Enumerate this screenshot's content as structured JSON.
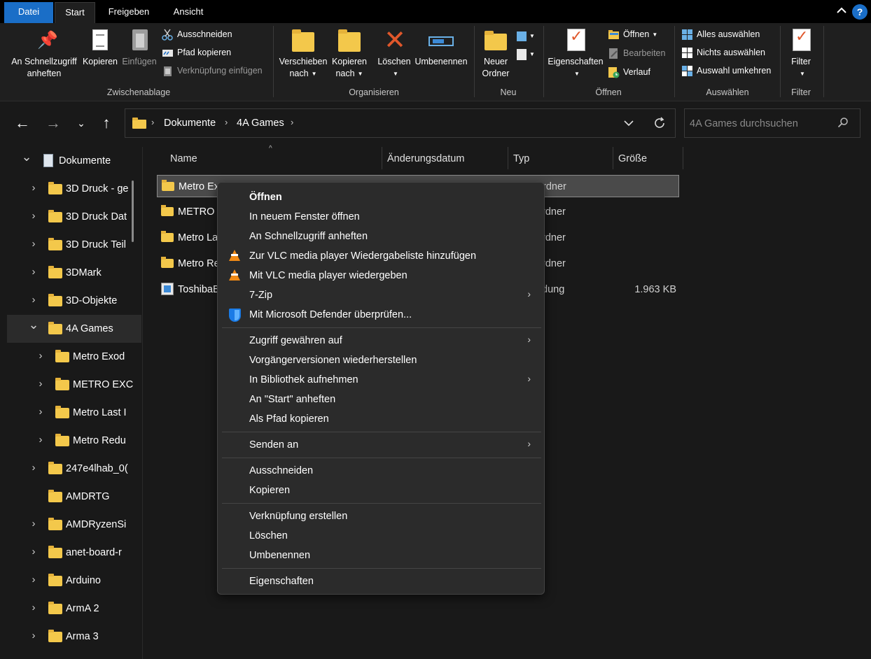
{
  "tabs": {
    "datei": "Datei",
    "start": "Start",
    "freigeben": "Freigeben",
    "ansicht": "Ansicht",
    "help": "?"
  },
  "ribbon": {
    "clipboard": {
      "pin_label_1": "An Schnellzugriff",
      "pin_label_2": "anheften",
      "copy": "Kopieren",
      "paste": "Einfügen",
      "cut": "Ausschneiden",
      "copy_path": "Pfad kopieren",
      "paste_shortcut": "Verknüpfung einfügen",
      "group": "Zwischenablage"
    },
    "organize": {
      "move_1": "Verschieben",
      "move_2": "nach",
      "copyto_1": "Kopieren",
      "copyto_2": "nach",
      "delete": "Löschen",
      "rename": "Umbenennen",
      "group": "Organisieren"
    },
    "new": {
      "folder_1": "Neuer",
      "folder_2": "Ordner",
      "group": "Neu"
    },
    "open": {
      "properties": "Eigenschaften",
      "open": "Öffnen",
      "edit": "Bearbeiten",
      "history": "Verlauf",
      "group": "Öffnen"
    },
    "select": {
      "all": "Alles auswählen",
      "none": "Nichts auswählen",
      "invert": "Auswahl umkehren",
      "group": "Auswählen"
    },
    "filter": {
      "label": "Filter",
      "group": "Filter"
    }
  },
  "address": {
    "crumbs": [
      "Dokumente",
      "4A Games"
    ],
    "search_placeholder": "4A Games durchsuchen"
  },
  "sidebar": {
    "items": [
      {
        "label": "Dokumente",
        "expanded": true,
        "level": 0,
        "icon": "documents-icon"
      },
      {
        "label": "3D Druck - ge",
        "level": 1
      },
      {
        "label": "3D Druck Dat",
        "level": 1
      },
      {
        "label": "3D Druck Teil",
        "level": 1
      },
      {
        "label": "3DMark",
        "level": 1
      },
      {
        "label": "3D-Objekte",
        "level": 1
      },
      {
        "label": "4A Games",
        "level": 1,
        "expanded": true,
        "selected": true
      },
      {
        "label": "Metro Exod",
        "level": 2
      },
      {
        "label": "METRO EXC",
        "level": 2
      },
      {
        "label": "Metro Last I",
        "level": 2
      },
      {
        "label": "Metro Redu",
        "level": 2
      },
      {
        "label": "247e4lhab_0(",
        "level": 1
      },
      {
        "label": "AMDRTG",
        "level": 1,
        "no_expander": true
      },
      {
        "label": "AMDRyzenSi",
        "level": 1
      },
      {
        "label": "anet-board-r",
        "level": 1
      },
      {
        "label": "Arduino",
        "level": 1
      },
      {
        "label": "ArmA 2",
        "level": 1
      },
      {
        "label": "Arma 3",
        "level": 1
      }
    ]
  },
  "columns": {
    "name": "Name",
    "date": "Änderungsdatum",
    "type": "Typ",
    "size": "Größe"
  },
  "files": [
    {
      "name": "Metro Ex",
      "type": "rdner",
      "size": "",
      "selected": true
    },
    {
      "name": "METRO I",
      "type": "rdner",
      "size": ""
    },
    {
      "name": "Metro La",
      "type": "rdner",
      "size": ""
    },
    {
      "name": "Metro Re",
      "type": "rdner",
      "size": ""
    },
    {
      "name": "ToshibaB",
      "type": "dung",
      "size": "1.963 KB",
      "exe": true
    }
  ],
  "context_menu": {
    "items": [
      {
        "label": "Öffnen",
        "bold": true
      },
      {
        "label": "In neuem Fenster öffnen"
      },
      {
        "label": "An Schnellzugriff anheften"
      },
      {
        "label": "Zur VLC media player Wiedergabeliste hinzufügen",
        "icon": "vlc-icon"
      },
      {
        "label": "Mit VLC media player wiedergeben",
        "icon": "vlc-icon"
      },
      {
        "label": "7-Zip",
        "submenu": true
      },
      {
        "label": "Mit Microsoft Defender überprüfen...",
        "icon": "defender-shield-icon"
      },
      {
        "sep": true
      },
      {
        "label": "Zugriff gewähren auf",
        "submenu": true
      },
      {
        "label": "Vorgängerversionen wiederherstellen"
      },
      {
        "label": "In Bibliothek aufnehmen",
        "submenu": true
      },
      {
        "label": "An \"Start\" anheften"
      },
      {
        "label": "Als Pfad kopieren"
      },
      {
        "sep": true
      },
      {
        "label": "Senden an",
        "submenu": true
      },
      {
        "sep": true
      },
      {
        "label": "Ausschneiden"
      },
      {
        "label": "Kopieren"
      },
      {
        "sep": true
      },
      {
        "label": "Verknüpfung erstellen"
      },
      {
        "label": "Löschen"
      },
      {
        "label": "Umbenennen"
      },
      {
        "sep": true
      },
      {
        "label": "Eigenschaften"
      }
    ]
  },
  "colors": {
    "accent": "#1a6ec7",
    "background": "#191919",
    "ribbon": "#1f1f1f",
    "menu": "#2b2b2b",
    "folder": "#f3c84b"
  }
}
